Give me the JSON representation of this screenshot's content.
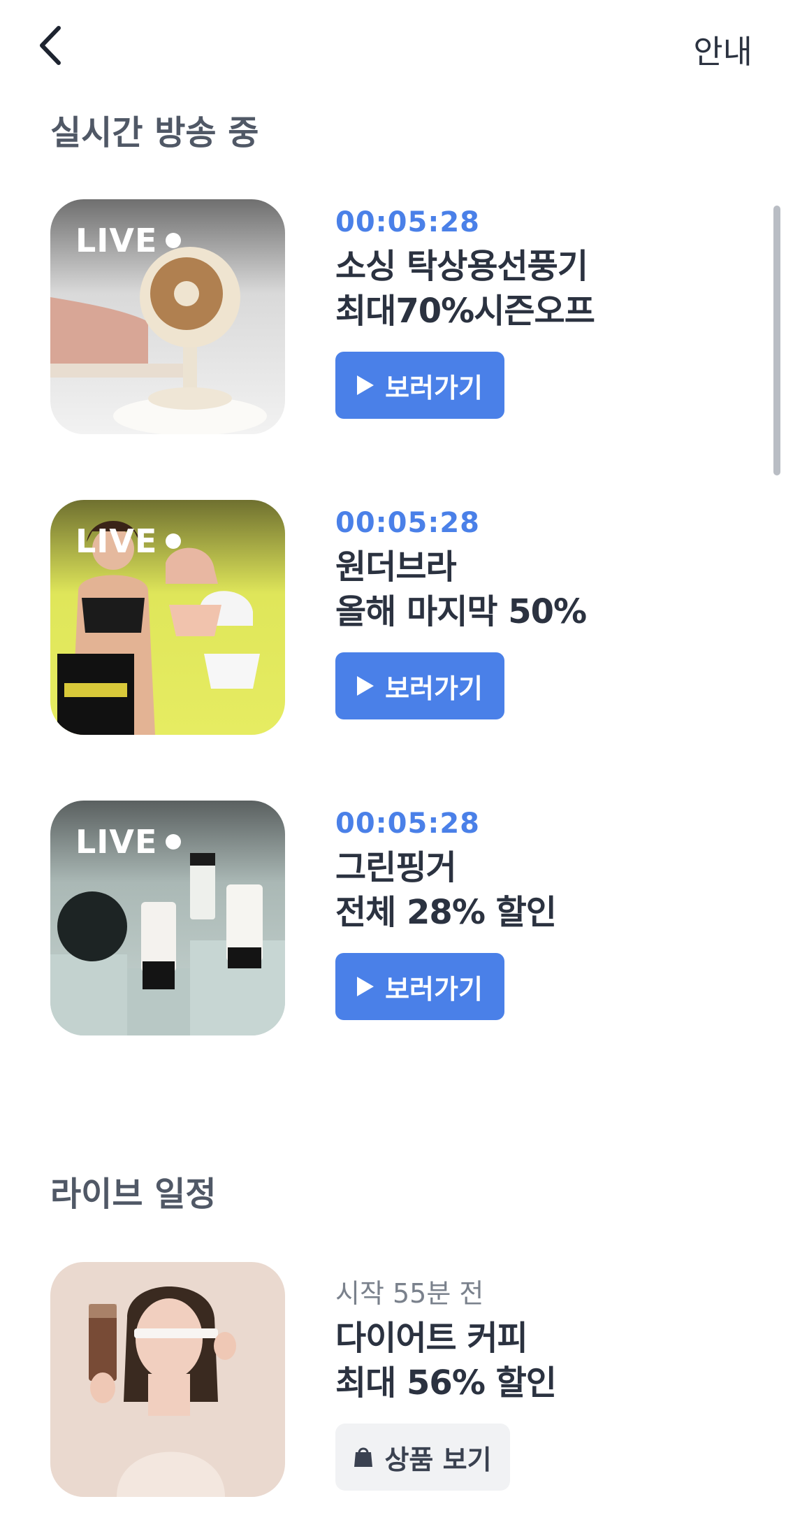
{
  "header": {
    "info_label": "안내"
  },
  "live_section": {
    "title": "실시간 방송 중",
    "badge": "LIVE",
    "watch_label": "보러가기",
    "items": [
      {
        "timer": "00:05:28",
        "title_line1": "소싱 탁상용선풍기",
        "title_line2": "최대70%시즌오프"
      },
      {
        "timer": "00:05:28",
        "title_line1": "원더브라",
        "title_line2": "올해 마지막 50%"
      },
      {
        "timer": "00:05:28",
        "title_line1": "그린핑거",
        "title_line2": "전체 28% 할인"
      }
    ]
  },
  "schedule_section": {
    "title": "라이브 일정",
    "items": [
      {
        "start": "시작 55분 전",
        "title_line1": "다이어트 커피",
        "title_line2": "최대 56% 할인",
        "button_label": "상품 보기"
      }
    ]
  },
  "colors": {
    "accent": "#4a80e8",
    "text": "#2b3240",
    "muted": "#7a818c"
  }
}
